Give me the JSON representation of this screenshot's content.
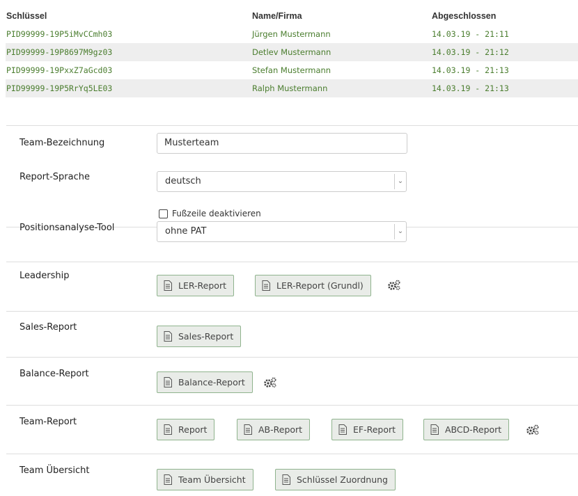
{
  "table": {
    "headers": [
      "Schlüssel",
      "Name/Firma",
      "Abgeschlossen"
    ],
    "rows": [
      {
        "key": "PID99999-19P5iMvCCmh03",
        "name": "Jürgen Mustermann",
        "date": "14.03.19 - 21:11"
      },
      {
        "key": "PID99999-19P8697M9gz03",
        "name": "Detlev Mustermann",
        "date": "14.03.19 - 21:12"
      },
      {
        "key": "PID99999-19PxxZ7aGcd03",
        "name": "Stefan Mustermann",
        "date": "14.03.19 - 21:13"
      },
      {
        "key": "PID99999-19P5RrYq5LE03",
        "name": "Ralph Mustermann",
        "date": "14.03.19 - 21:13"
      }
    ]
  },
  "form": {
    "team_label": "Team-Bezeichnung",
    "team_value": "Musterteam",
    "lang_label": "Report-Sprache",
    "lang_value": "deutsch",
    "footer_checkbox": "Fußzeile deaktivieren",
    "pat_label": "Positionsanalyse-Tool",
    "pat_value": "ohne PAT"
  },
  "reports": {
    "leadership_label": "Leadership",
    "ler_report": "LER-Report",
    "ler_report_grundl": "LER-Report (Grundl)",
    "sales_label": "Sales-Report",
    "sales_report": "Sales-Report",
    "balance_label": "Balance-Report",
    "balance_report": "Balance-Report",
    "team_label": "Team-Report",
    "report": "Report",
    "ab_report": "AB-Report",
    "ef_report": "EF-Report",
    "abcd_report": "ABCD-Report",
    "overview_label": "Team Übersicht",
    "team_overview": "Team Übersicht",
    "key_assignment": "Schlüssel Zuordnung"
  },
  "icons": {
    "document": "document-icon",
    "settings": "gears-icon",
    "dropdown": "chevron-down-icon"
  },
  "colors": {
    "link_green": "#4a7d2e",
    "button_border": "#8fb38d",
    "button_bg": "#e9ece8",
    "row_alt": "#eeeeee"
  }
}
